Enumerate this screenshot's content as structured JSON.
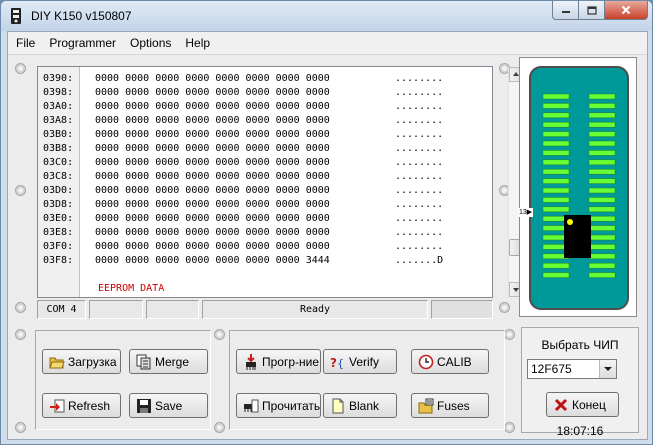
{
  "window": {
    "title": "DIY K150 v150807"
  },
  "menu": [
    "File",
    "Programmer",
    "Options",
    "Help"
  ],
  "hex_rows": [
    {
      "addr": "0390:",
      "bytes": "0000 0000 0000 0000 0000 0000 0000 0000",
      "ascii": "........"
    },
    {
      "addr": "0398:",
      "bytes": "0000 0000 0000 0000 0000 0000 0000 0000",
      "ascii": "........"
    },
    {
      "addr": "03A0:",
      "bytes": "0000 0000 0000 0000 0000 0000 0000 0000",
      "ascii": "........"
    },
    {
      "addr": "03A8:",
      "bytes": "0000 0000 0000 0000 0000 0000 0000 0000",
      "ascii": "........"
    },
    {
      "addr": "03B0:",
      "bytes": "0000 0000 0000 0000 0000 0000 0000 0000",
      "ascii": "........"
    },
    {
      "addr": "03B8:",
      "bytes": "0000 0000 0000 0000 0000 0000 0000 0000",
      "ascii": "........"
    },
    {
      "addr": "03C0:",
      "bytes": "0000 0000 0000 0000 0000 0000 0000 0000",
      "ascii": "........"
    },
    {
      "addr": "03C8:",
      "bytes": "0000 0000 0000 0000 0000 0000 0000 0000",
      "ascii": "........"
    },
    {
      "addr": "03D0:",
      "bytes": "0000 0000 0000 0000 0000 0000 0000 0000",
      "ascii": "........"
    },
    {
      "addr": "03D8:",
      "bytes": "0000 0000 0000 0000 0000 0000 0000 0000",
      "ascii": "........"
    },
    {
      "addr": "03E0:",
      "bytes": "0000 0000 0000 0000 0000 0000 0000 0000",
      "ascii": "........"
    },
    {
      "addr": "03E8:",
      "bytes": "0000 0000 0000 0000 0000 0000 0000 0000",
      "ascii": "........"
    },
    {
      "addr": "03F0:",
      "bytes": "0000 0000 0000 0000 0000 0000 0000 0000",
      "ascii": "........"
    },
    {
      "addr": "03F8:",
      "bytes": "0000 0000 0000 0000 0000 0000 0000 3444",
      "ascii": ".......D"
    }
  ],
  "eeprom_label": "EEPROM DATA",
  "status": {
    "port": "COM 4",
    "message": "Ready"
  },
  "chip_board": {
    "socket_marker": "13▶"
  },
  "buttons": {
    "load": "Загрузка",
    "merge": "Merge",
    "refresh": "Refresh",
    "save": "Save",
    "program": "Прогр-ние",
    "verify": "Verify",
    "calib": "CALIB",
    "read": "Прочитать",
    "blank": "Blank",
    "fuses": "Fuses",
    "exit": "Конец"
  },
  "chip_select": {
    "label": "Выбрать ЧИП",
    "value": "12F675"
  },
  "time": "18:07:16",
  "colors": {
    "board": "#009999",
    "pins": "#66ff33",
    "eeprom_label": "#cc0000",
    "chip_dot": "#ffff00"
  }
}
